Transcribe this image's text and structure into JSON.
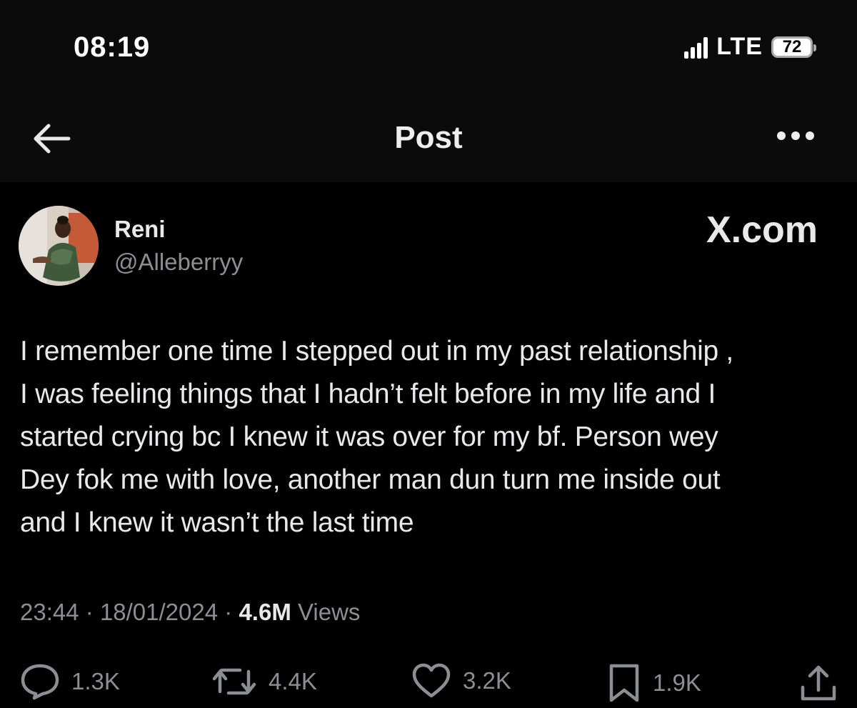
{
  "status_bar": {
    "time": "08:19",
    "network": "LTE",
    "battery": "72"
  },
  "nav": {
    "title": "Post",
    "back_icon": "arrow-left-icon",
    "more_icon": "more-horizontal-icon"
  },
  "post": {
    "author_name": "Reni",
    "author_handle": "@Alleberryy",
    "watermark": "X.com",
    "text": "I remember one time I stepped out in my past relationship ,\nI was feeling things that I hadn’t felt before in my life and I\nstarted crying bc I knew it was over for my bf. Person wey\nDey fok me with love, another man dun turn me inside out\nand I knew it wasn’t the last time",
    "time": "23:44",
    "date": "18/01/2024",
    "views_count": "4.6M",
    "views_label": "Views",
    "separator": "·"
  },
  "actions": {
    "replies": "1.3K",
    "reposts": "4.4K",
    "likes": "3.2K",
    "bookmarks": "1.9K",
    "icons": [
      "reply-icon",
      "repost-icon",
      "like-icon",
      "bookmark-icon",
      "share-icon"
    ]
  },
  "colors": {
    "background": "#000000",
    "bar_background": "#0b0b0b",
    "primary_text": "#e7e9ea",
    "secondary_text": "#8b8f94"
  }
}
